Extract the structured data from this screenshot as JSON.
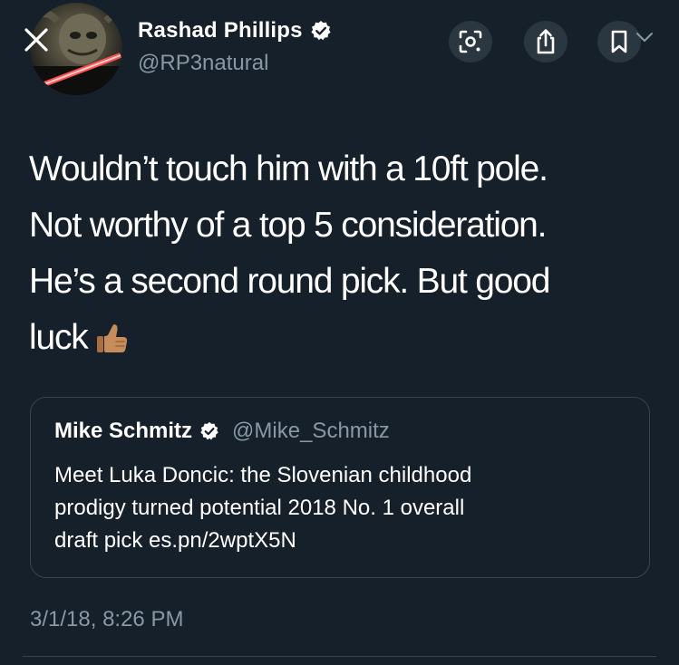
{
  "author": {
    "name": "Rashad Phillips",
    "handle": "@RP3natural",
    "verified": true,
    "avatar_icon": "masked-figure-lightsaber-avatar"
  },
  "header_actions": [
    {
      "icon": "lens-scan-icon"
    },
    {
      "icon": "share-icon"
    },
    {
      "icon": "bookmark-icon"
    }
  ],
  "tweet": {
    "lines": [
      "Wouldn’t touch him with a 10ft pole.",
      "Not worthy of a top 5 consideration.",
      "He’s a second round pick. But good",
      "luck"
    ],
    "emoji": "thumbs-up-icon"
  },
  "quoted_tweet": {
    "name": "Mike Schmitz",
    "handle": "@Mike_Schmitz",
    "verified": true,
    "lines": [
      "Meet Luka Doncic: the Slovenian childhood",
      "prodigy turned potential 2018 No. 1 overall",
      "draft pick es.pn/2wptX5N"
    ]
  },
  "timestamp": "3/1/18, 8:26 PM",
  "colors": {
    "background": "#15202b",
    "secondary_text": "#8899a6",
    "border": "#38444d"
  }
}
